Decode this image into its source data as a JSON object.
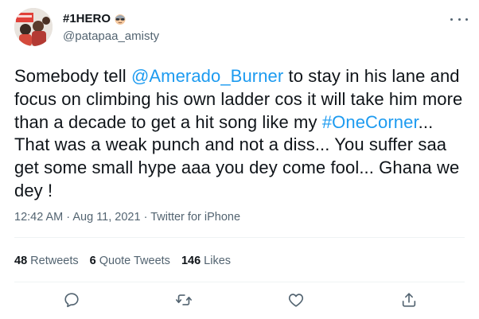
{
  "user": {
    "display_name": "#1HERO",
    "handle": "@patapaa_amisty",
    "avatar_icon": "profile-photo",
    "badge_emoji": "man-with-sunglasses-emoji"
  },
  "tweet": {
    "text_1": "Somebody tell ",
    "mention": "@Amerado_Burner",
    "text_2": " to stay in his lane and focus on climbing his own ladder cos it will take him more than a decade to get a hit song like my ",
    "hashtag": "#OneCorner",
    "text_3": "... That was a weak punch and not a diss... You suffer saa get some small hype aaa you dey come fool... Ghana we dey !"
  },
  "meta": {
    "time": "12:42 AM",
    "sep1": " · ",
    "date": "Aug 11, 2021",
    "sep2": " · ",
    "source": "Twitter for iPhone"
  },
  "stats": {
    "retweets_count": "48",
    "retweets_label": "Retweets",
    "quotes_count": "6",
    "quotes_label": "Quote Tweets",
    "likes_count": "146",
    "likes_label": "Likes"
  },
  "colors": {
    "link": "#1d9bf0",
    "secondary_text": "#536471",
    "divider": "#eff3f4"
  },
  "icons": {
    "more": "more-options-icon",
    "reply": "reply-icon",
    "retweet": "retweet-icon",
    "like": "heart-icon",
    "share": "share-icon"
  }
}
